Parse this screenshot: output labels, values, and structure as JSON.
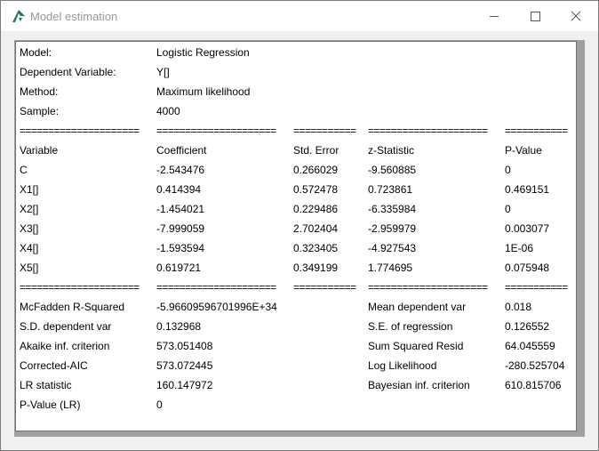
{
  "window": {
    "title": "Model estimation"
  },
  "header": [
    {
      "label": "Model:",
      "value": "Logistic Regression"
    },
    {
      "label": "Dependent Variable:",
      "value": "Y[]"
    },
    {
      "label": "Method:",
      "value": "Maximum likelihood"
    },
    {
      "label": "Sample:",
      "value": "4000"
    }
  ],
  "separators": [
    "=====================",
    "=====================",
    "===========",
    "=====================",
    "==========="
  ],
  "table": {
    "columns": [
      "Variable",
      "Coefficient",
      "Std. Error",
      "z-Statistic",
      "P-Value"
    ],
    "rows": [
      [
        "C",
        "-2.543476",
        "0.266029",
        "-9.560885",
        "0"
      ],
      [
        "X1[]",
        "0.414394",
        "0.572478",
        "0.723861",
        "0.469151"
      ],
      [
        "X2[]",
        "-1.454021",
        "0.229486",
        "-6.335984",
        "0"
      ],
      [
        "X3[]",
        "-7.999059",
        "2.702404",
        "-2.959979",
        "0.003077"
      ],
      [
        "X4[]",
        "-1.593594",
        "0.323405",
        "-4.927543",
        "1E-06"
      ],
      [
        "X5[]",
        "0.619721",
        "0.349199",
        "1.774695",
        "0.075948"
      ]
    ]
  },
  "stats": [
    [
      "McFadden R-Squared",
      "-5.96609596701996E+34",
      "Mean dependent var",
      "0.018"
    ],
    [
      "S.D. dependent var",
      "0.132968",
      "S.E. of regression",
      "0.126552"
    ],
    [
      "Akaike inf. criterion",
      "573.051408",
      "Sum Squared Resid",
      "64.045559"
    ],
    [
      "Corrected-AIC",
      "573.072445",
      "Log Likelihood",
      "-280.525704"
    ],
    [
      "LR statistic",
      "160.147972",
      "Bayesian inf. criterion",
      "610.815706"
    ],
    [
      "P-Value (LR)",
      "0",
      "",
      ""
    ]
  ]
}
